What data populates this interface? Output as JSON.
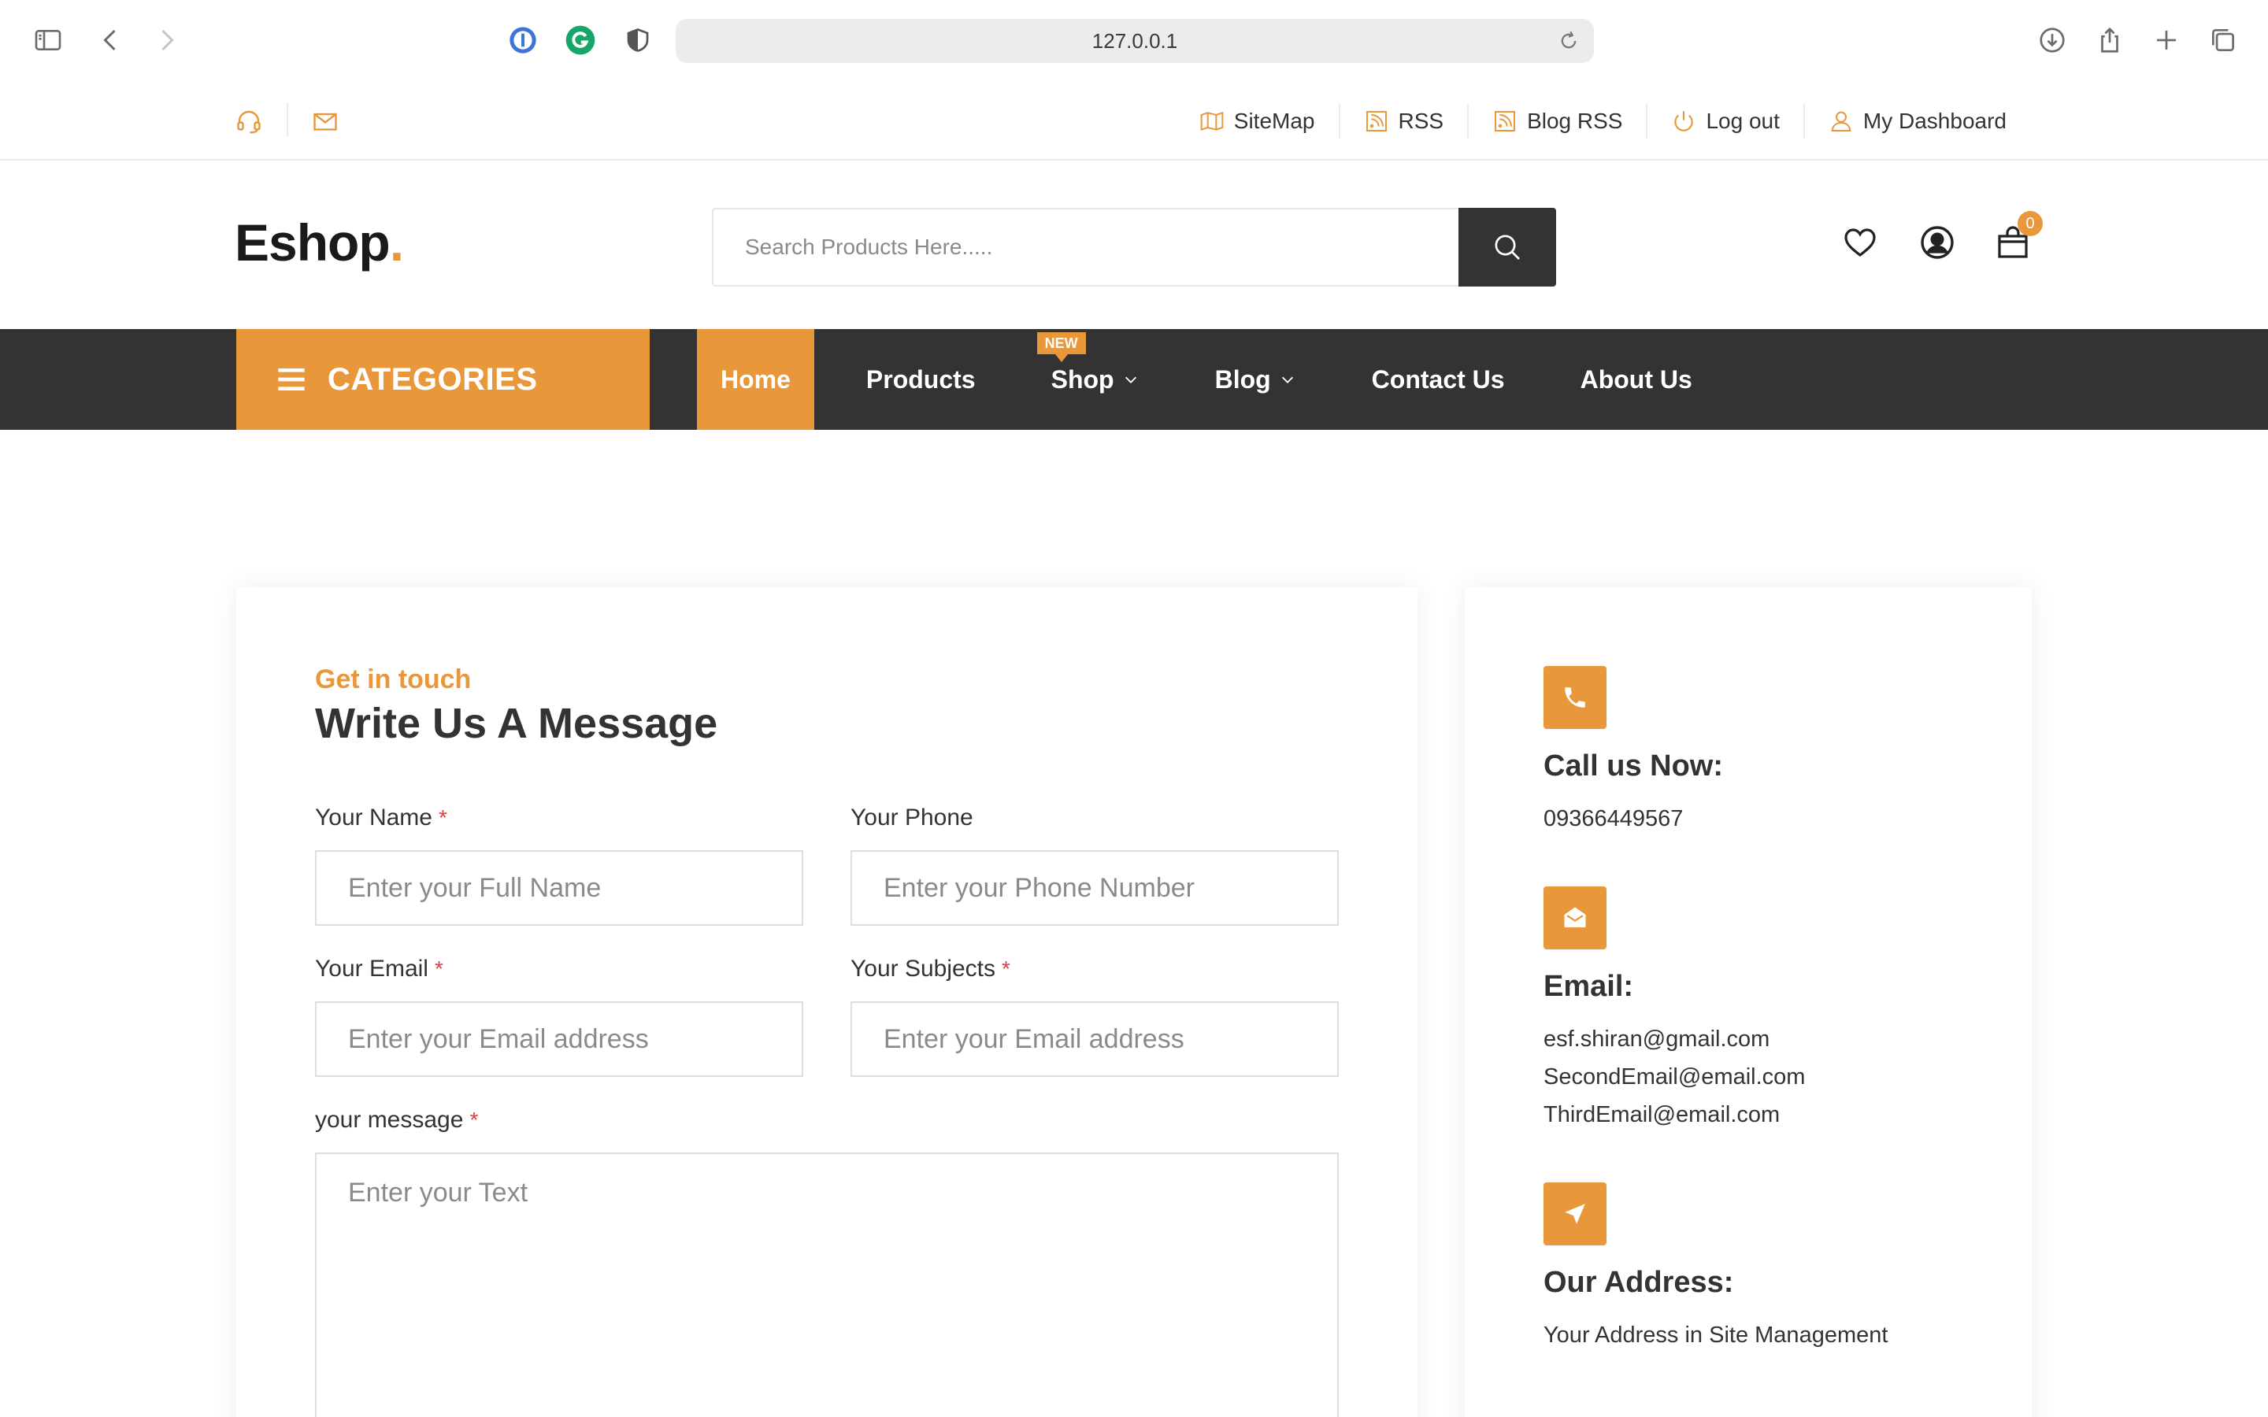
{
  "browser": {
    "url": "127.0.0.1"
  },
  "topbar": {
    "links": [
      {
        "label": "SiteMap",
        "icon": "map-icon"
      },
      {
        "label": "RSS",
        "icon": "rss-icon"
      },
      {
        "label": "Blog RSS",
        "icon": "rss-icon"
      },
      {
        "label": "Log out",
        "icon": "power-icon"
      },
      {
        "label": "My Dashboard",
        "icon": "user-icon"
      }
    ]
  },
  "header": {
    "logo": "Eshop",
    "logo_dot": ".",
    "search_placeholder": "Search Products Here.....",
    "cart_count": "0"
  },
  "nav": {
    "categories_label": "CATEGORIES",
    "items": [
      {
        "label": "Home",
        "active": true
      },
      {
        "label": "Products"
      },
      {
        "label": "Shop",
        "badge": "NEW",
        "dropdown": true
      },
      {
        "label": "Blog",
        "dropdown": true
      },
      {
        "label": "Contact Us"
      },
      {
        "label": "About Us"
      }
    ]
  },
  "form": {
    "eyebrow": "Get in touch",
    "title": "Write Us A Message",
    "name_label": "Your Name",
    "name_placeholder": "Enter your Full Name",
    "phone_label": "Your Phone",
    "phone_placeholder": "Enter your Phone Number",
    "email_label": "Your Email",
    "email_placeholder": "Enter your Email address",
    "subject_label": "Your Subjects",
    "subject_placeholder": "Enter your Email address",
    "message_label": "your message",
    "message_placeholder": "Enter your Text",
    "required_mark": "*"
  },
  "contact_info": {
    "call_heading": "Call us Now:",
    "phone": "09366449567",
    "email_heading": "Email:",
    "emails": [
      "esf.shiran@gmail.com",
      "SecondEmail@email.com",
      "ThirdEmail@email.com"
    ],
    "address_heading": "Our Address:",
    "address": "Your Address in Site Management"
  },
  "colors": {
    "accent": "#e8973a",
    "nav_bg": "#333333",
    "required": "#e63b3b"
  }
}
